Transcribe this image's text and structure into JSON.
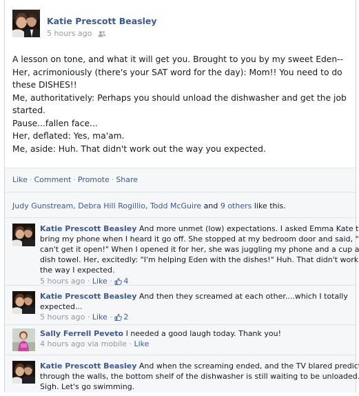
{
  "post": {
    "author": "Katie Prescott Beasley",
    "timestamp": "5 hours ago",
    "privacy_icon": "friends-icon",
    "body_lines": [
      "A lesson on tone, and what it will get you. Brought to you by my sweet Eden--",
      "Her, acrimoniously (there's your SAT word for the day): Mom!! You need to do",
      "these DISHES!!",
      "Me, authoritatively: Perhaps you should unload the dishwasher and get the job",
      "started.",
      "Pause...fallen face...",
      "Her, deflated: Yes, ma'am.",
      "Me, aside: Huh. That didn't work out the way you expected."
    ]
  },
  "actions": {
    "like": "Like",
    "comment": "Comment",
    "promote": "Promote",
    "share": "Share",
    "separator": "·"
  },
  "likes": {
    "names": "Judy Gunstream, Debra Hill Rogillio, Todd McGuire",
    "and": " and ",
    "others": "9 others",
    "suffix": " like this."
  },
  "comments": [
    {
      "author": "Katie Prescott Beasley",
      "lines": [
        " And more unmet (low) expectations. I asked Emma Kate to",
        "bring my phone when I heard it go off. She stopped at my bedroom door and said, \"I",
        "can't get it open!\" When I opened it for her, she was juggling my phone and a cup and a",
        "dish towel. Her, excitedly: \"I'm helping Eden with the dishes!\" Huh. That didn't work out",
        "the way I expected."
      ],
      "time": "5 hours ago",
      "like_label": "Like",
      "like_count": "4"
    },
    {
      "author": "Katie Prescott Beasley",
      "lines": [
        " And then they screamed at each other....which I totally",
        "expected..."
      ],
      "time": "5 hours ago",
      "like_label": "Like",
      "like_count": "2"
    },
    {
      "author": "Sally Ferrell Peveto",
      "lines": [
        " I needed a good laugh today. Thank you!"
      ],
      "time": "4 hours ago via mobile",
      "like_label": "Like"
    },
    {
      "author": "Katie Prescott Beasley",
      "lines": [
        " And when the screaming ended, and the TV blared predictably",
        "through the walls, the bottom shelf of the dishwasher is still waiting to be unloaded.",
        "Sigh. Let's go swimming."
      ]
    }
  ]
}
